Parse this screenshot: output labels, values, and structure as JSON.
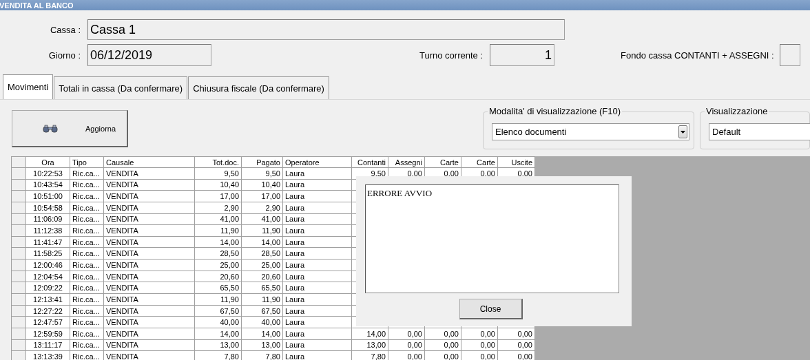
{
  "window": {
    "title": "VENDITA AL BANCO"
  },
  "header": {
    "cassa": {
      "label": "Cassa :",
      "value": "Cassa 1"
    },
    "giorno": {
      "label": "Giorno :",
      "value": "06/12/2019"
    },
    "turno": {
      "label": "Turno corrente :",
      "value": "1"
    },
    "fondo": {
      "label": "Fondo cassa CONTANTI + ASSEGNI :"
    }
  },
  "tabs": [
    {
      "label": "Movimenti",
      "selected": true
    },
    {
      "label": "Totali in cassa (Da confermare)",
      "selected": false
    },
    {
      "label": "Chiusura fiscale (Da confermare)",
      "selected": false
    }
  ],
  "refresh_button": {
    "label": "Aggiorna"
  },
  "view_groups": [
    {
      "title": "Modalita' di visualizzazione (F10)",
      "value": "Elenco documenti"
    },
    {
      "title": "Visualizzazione",
      "value": "Default"
    }
  ],
  "table": {
    "columns": [
      "Ora",
      "Tipo",
      "Causale",
      "Tot.doc.",
      "Pagato",
      "Operatore",
      "Contanti",
      "Assegni",
      "Carte",
      "Carte",
      "Uscite"
    ],
    "rows": [
      {
        "cells": [
          "10:22:53",
          "Ric.ca...",
          "VENDITA",
          "9,50",
          "9,50",
          "Laura",
          "9,50",
          "0,00",
          "0,00",
          "0,00",
          "0,00"
        ]
      },
      {
        "cells": [
          "10:43:54",
          "Ric.ca...",
          "VENDITA",
          "10,40",
          "10,40",
          "Laura"
        ]
      },
      {
        "cells": [
          "10:51:00",
          "Ric.ca...",
          "VENDITA",
          "17,00",
          "17,00",
          "Laura"
        ]
      },
      {
        "cells": [
          "10:54:58",
          "Ric.ca...",
          "VENDITA",
          "2,90",
          "2,90",
          "Laura"
        ]
      },
      {
        "cells": [
          "11:06:09",
          "Ric.ca...",
          "VENDITA",
          "41,00",
          "41,00",
          "Laura"
        ]
      },
      {
        "cells": [
          "11:12:38",
          "Ric.ca...",
          "VENDITA",
          "11,90",
          "11,90",
          "Laura"
        ]
      },
      {
        "cells": [
          "11:41:47",
          "Ric.ca...",
          "VENDITA",
          "14,00",
          "14,00",
          "Laura"
        ]
      },
      {
        "cells": [
          "11:58:25",
          "Ric.ca...",
          "VENDITA",
          "28,50",
          "28,50",
          "Laura"
        ]
      },
      {
        "cells": [
          "12:00:46",
          "Ric.ca...",
          "VENDITA",
          "25,00",
          "25,00",
          "Laura"
        ]
      },
      {
        "cells": [
          "12:04:54",
          "Ric.ca...",
          "VENDITA",
          "20,60",
          "20,60",
          "Laura"
        ]
      },
      {
        "cells": [
          "12:09:22",
          "Ric.ca...",
          "VENDITA",
          "65,50",
          "65,50",
          "Laura"
        ]
      },
      {
        "cells": [
          "12:13:41",
          "Ric.ca...",
          "VENDITA",
          "11,90",
          "11,90",
          "Laura"
        ]
      },
      {
        "cells": [
          "12:27:22",
          "Ric.ca...",
          "VENDITA",
          "67,50",
          "67,50",
          "Laura"
        ]
      },
      {
        "cells": [
          "12:47:57",
          "Ric.ca...",
          "VENDITA",
          "40,00",
          "40,00",
          "Laura"
        ]
      },
      {
        "cells": [
          "12:59:59",
          "Ric.ca...",
          "VENDITA",
          "14,00",
          "14,00",
          "Laura",
          "14,00",
          "0,00",
          "0,00",
          "0,00",
          "0,00"
        ]
      },
      {
        "cells": [
          "13:11:17",
          "Ric.ca...",
          "VENDITA",
          "13,00",
          "13,00",
          "Laura",
          "13,00",
          "0,00",
          "0,00",
          "0,00",
          "0,00"
        ]
      },
      {
        "cells": [
          "13:13:39",
          "Ric.ca...",
          "VENDITA",
          "7,80",
          "7,80",
          "Laura",
          "7,80",
          "0,00",
          "0,00",
          "0,00",
          "0,00"
        ]
      }
    ]
  },
  "dialog": {
    "message": "ERRORE AVVIO",
    "button": "Close"
  }
}
